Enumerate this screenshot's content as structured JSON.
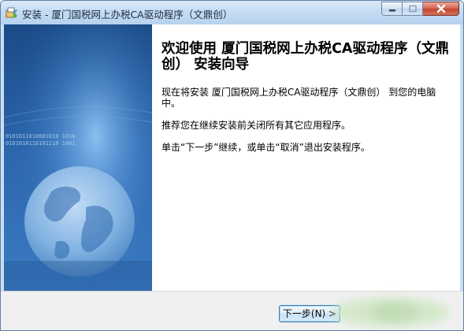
{
  "window": {
    "title": "安装 - 厦门国税网上办税CA驱动程序（文鼎创）"
  },
  "welcome": {
    "heading": "欢迎使用 厦门国税网上办税CA驱动程序（文鼎创） 安装向导",
    "paragraph1": "现在将安装 厦门国税网上办税CA驱动程序（文鼎创） 到您的电脑中。",
    "paragraph2": "推荐您在继续安装前关闭所有其它应用程序。",
    "paragraph3": "单击“下一步”继续，或单击“取消”退出安装程序。"
  },
  "buttons": {
    "next_label": "下一步(N) >"
  },
  "colors": {
    "banner_top": "#1f4f8c",
    "banner_bottom": "#2f6fb8",
    "titlebar": "#c6dcf4",
    "close_button": "#c0452f"
  }
}
